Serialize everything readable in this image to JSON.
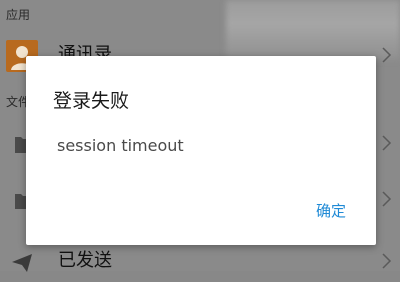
{
  "background": {
    "section_apps": "应用",
    "section_docs": "文件",
    "items": [
      {
        "label": "通讯录",
        "icon": "contact-avatar-icon"
      },
      {
        "label": "",
        "icon": "folder-icon"
      },
      {
        "label": "",
        "icon": "file-folder-icon"
      },
      {
        "label": "已发送",
        "icon": "send-paper-plane-icon"
      }
    ]
  },
  "dialog": {
    "title": "登录失败",
    "message": "session timeout",
    "confirm_label": "确定"
  },
  "colors": {
    "overlay_bg": "#8a8a8a",
    "dialog_bg": "#ffffff",
    "accent": "#1f8ad6",
    "avatar": "#b86a1f"
  }
}
